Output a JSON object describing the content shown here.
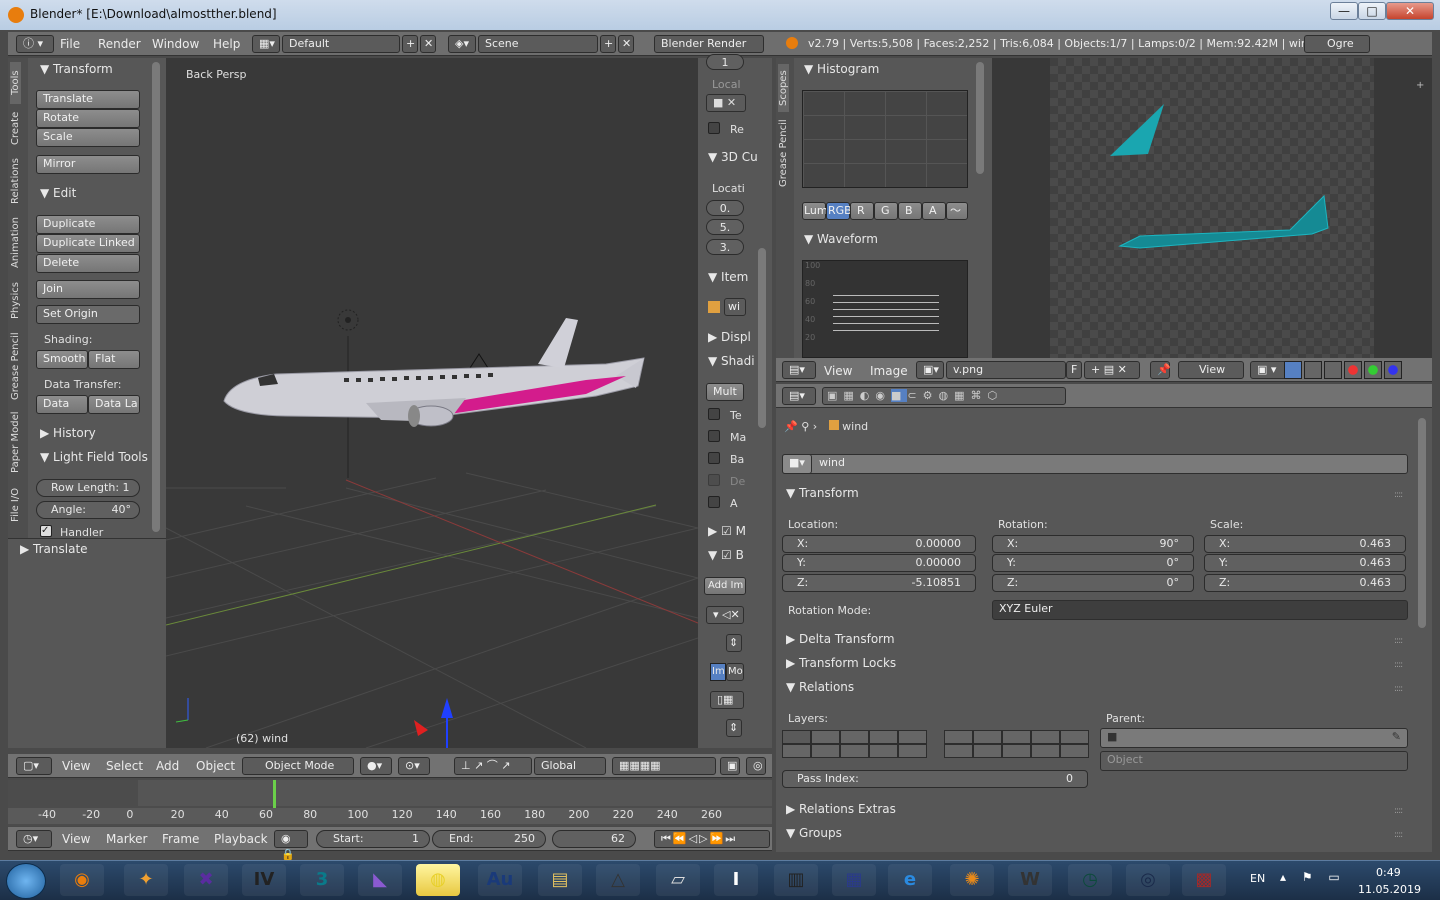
{
  "titlebar": {
    "title": "Blender* [E:\\Download\\almostther.blend]",
    "minimize": "—",
    "maximize": "□",
    "close": "✕"
  },
  "topbar": {
    "menus": [
      "File",
      "Render",
      "Window",
      "Help"
    ],
    "layout": "Default",
    "scene": "Scene",
    "engine": "Blender Render",
    "stats": "v2.79 | Verts:5,508 | Faces:2,252 | Tris:6,084 | Objects:1/7 | Lamps:0/2 | Mem:92.42M | wind",
    "ogre": "Ogre"
  },
  "toolshelf": {
    "tabs": [
      "Tools",
      "Create",
      "Relations",
      "Animation",
      "Physics",
      "Grease Pencil",
      "Paper Model",
      "File I/O"
    ],
    "transform_title": "Transform",
    "transform_buttons": [
      "Translate",
      "Rotate",
      "Scale"
    ],
    "mirror": "Mirror",
    "edit_title": "Edit",
    "edit_buttons": [
      "Duplicate",
      "Duplicate Linked",
      "Delete"
    ],
    "join": "Join",
    "set_origin": "Set Origin",
    "shading_label": "Shading:",
    "smooth": "Smooth",
    "flat": "Flat",
    "data_transfer_label": "Data Transfer:",
    "data": "Data",
    "data_la": "Data La",
    "history": "History",
    "light_field": "Light Field Tools",
    "row_length_label": "Row Length:",
    "row_length": "1",
    "angle_label": "Angle:",
    "angle": "40°",
    "handler": "Handler",
    "translate_op": "Translate"
  },
  "viewport": {
    "label": "Back Persp",
    "status": "(62) wind",
    "header_menus": [
      "View",
      "Select",
      "Add",
      "Object"
    ],
    "mode": "Object Mode",
    "orientation": "Global"
  },
  "npanel": {
    "top_num": "1",
    "local": "Local",
    "re": "Re",
    "cursor": "3D Cu",
    "locati": "Locati",
    "loc_vals": [
      "0.",
      "5.",
      "3."
    ],
    "item": "Item",
    "wi": "wi",
    "displ": "Displ",
    "shadi": "Shadi",
    "mult": "Mult",
    "checks": [
      "Te",
      "Ma",
      "Ba",
      "De",
      "A"
    ],
    "m": "M",
    "b": "B",
    "add_im": "Add Im",
    "im": "Im",
    "mo": "Mo"
  },
  "scopes": {
    "tabs": [
      "Scopes",
      "Grease Pencil"
    ],
    "histogram": "Histogram",
    "channels": [
      "Lum",
      "RGB",
      "R",
      "G",
      "B",
      "A"
    ],
    "waveform": "Waveform",
    "wave_ticks": [
      "100",
      "80",
      "60",
      "40",
      "20"
    ]
  },
  "image_header": {
    "menus": [
      "View",
      "Image"
    ],
    "image_name": "v.png",
    "f": "F",
    "view": "View"
  },
  "properties": {
    "object_name": "wind",
    "data_name": "wind",
    "transform": "Transform",
    "location_label": "Location:",
    "rotation_label": "Rotation:",
    "scale_label": "Scale:",
    "location": [
      {
        "axis": "X:",
        "value": "0.00000"
      },
      {
        "axis": "Y:",
        "value": "0.00000"
      },
      {
        "axis": "Z:",
        "value": "-5.10851"
      }
    ],
    "rotation": [
      {
        "axis": "X:",
        "value": "90°"
      },
      {
        "axis": "Y:",
        "value": "0°"
      },
      {
        "axis": "Z:",
        "value": "0°"
      }
    ],
    "scale": [
      {
        "axis": "X:",
        "value": "0.463"
      },
      {
        "axis": "Y:",
        "value": "0.463"
      },
      {
        "axis": "Z:",
        "value": "0.463"
      }
    ],
    "rotation_mode_label": "Rotation Mode:",
    "rotation_mode": "XYZ Euler",
    "delta_transform": "Delta Transform",
    "transform_locks": "Transform Locks",
    "relations": "Relations",
    "layers_label": "Layers:",
    "parent_label": "Parent:",
    "parent_type": "Object",
    "pass_index_label": "Pass Index:",
    "pass_index": "0",
    "relations_extras": "Relations Extras",
    "groups": "Groups"
  },
  "timeline": {
    "ruler": [
      "-40",
      "-20",
      "0",
      "20",
      "40",
      "60",
      "80",
      "100",
      "120",
      "140",
      "160",
      "180",
      "200",
      "220",
      "240",
      "260"
    ],
    "menus": [
      "View",
      "Marker",
      "Frame",
      "Playback"
    ],
    "start_label": "Start:",
    "start": "1",
    "end_label": "End:",
    "end": "250",
    "current": "62"
  },
  "taskbar": {
    "apps": [
      "blender-icon",
      "network-icon",
      "x-app-icon",
      "iv-icon",
      "3ds-icon",
      "vs-icon",
      "globe-icon",
      "audition-icon",
      "folder-icon",
      "triangle-icon",
      "paper-icon",
      "word-doc-icon",
      "piano-icon",
      "keyboard-icon",
      "ie-icon",
      "sun-icon",
      "w-icon",
      "clock-app-icon",
      "steam-icon",
      "archive-icon"
    ],
    "lang": "EN",
    "time": "0:49",
    "date": "11.05.2019"
  }
}
